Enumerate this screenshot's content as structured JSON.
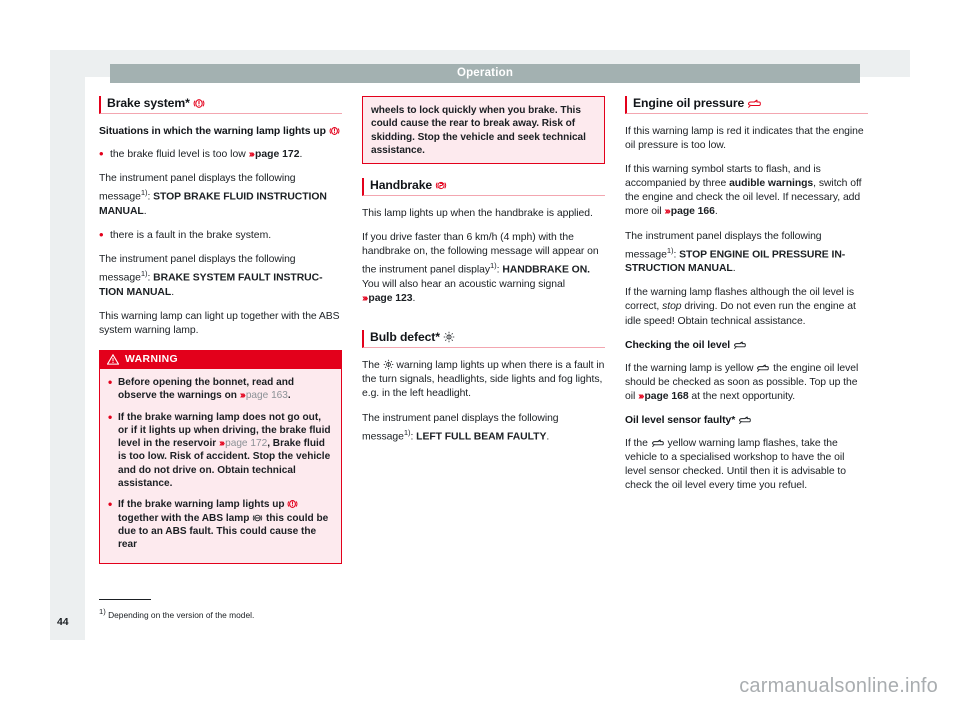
{
  "page": {
    "running_head": "Operation",
    "folio": "44",
    "footnote": "Depending on the version of the model.",
    "footnote_marker": "1)",
    "watermark": "carmanualsonline.info"
  },
  "colors": {
    "accent_red": "#e3001b",
    "warning_bar": "#e3001b",
    "warning_body": "#fdeaee",
    "running_head_bg": "#a3b1b1",
    "page_border": "#eceff0",
    "rule_pink": "#f3a6b0",
    "xref_grey": "#8b9196"
  },
  "column_1": {
    "section": {
      "title": "Brake system*",
      "icon": "brake-warning-icon"
    },
    "subheading": {
      "text": "Situations in which the warning lamp lights up",
      "icon": "brake-warning-icon"
    },
    "bullet_1": {
      "text": "the brake fluid level is too low",
      "xref_arrow": "›››",
      "xref_page": "page 172",
      "tail": "."
    },
    "para_1": {
      "lead": "The instrument panel displays the following message",
      "marker": "1)",
      "colon": ": ",
      "bold": "STOP BRAKE FLUID INSTRUCTION MANUAL",
      "tail": "."
    },
    "bullet_2": {
      "text": "there is a fault in the brake system."
    },
    "para_2": {
      "lead": "The instrument panel displays the following message",
      "marker": "1)",
      "colon": ": ",
      "bold": "BRAKE SYSTEM FAULT INSTRUC-TION MANUAL",
      "tail": "."
    },
    "para_3": "This warning lamp can light up together with the ABS system warning lamp.",
    "warning": {
      "label": "WARNING",
      "icon": "warning-triangle-icon",
      "items": [
        {
          "pre": "Before opening the bonnet, read and observe the warnings on ",
          "xref_arrow": "›››",
          "xref_page": "page 163",
          "post": "."
        },
        {
          "pre": "If the brake warning lamp does not go out, or if it lights up when driving, the brake fluid level in the reservoir ",
          "xref_arrow": "›››",
          "xref_page": "page 172",
          "post": ", Brake fluid is too low. Risk of accident. Stop the vehicle and do not drive on. Obtain technical assistance."
        },
        {
          "pre": "If the brake warning lamp lights up ",
          "icon_1": "brake-warning-icon",
          "mid": " together with the ABS lamp ",
          "icon_2": "abs-warning-icon",
          "post": " this could be due to an ABS fault. This could cause the rear"
        }
      ]
    }
  },
  "column_2": {
    "warning_continued": "wheels to lock quickly when you brake. This could cause the rear to break away. Risk of skidding. Stop the vehicle and seek technical assistance.",
    "handbrake": {
      "section": {
        "title": "Handbrake",
        "icon": "handbrake-p-icon"
      },
      "para_1": "This lamp lights up when the handbrake is applied.",
      "para_2": {
        "lead": "If you drive faster than 6 km/h (4 mph) with the handbrake on, the following message will appear on the instrument panel display",
        "marker": "1)",
        "colon": ": ",
        "bold": "HANDBRAKE ON.",
        "mid": " You will also hear an acoustic warning signal ",
        "xref_arrow": "›››",
        "xref_page": "page 123",
        "tail": "."
      }
    },
    "bulb": {
      "section": {
        "title": "Bulb defect*",
        "icon": "bulb-defect-icon"
      },
      "para_1": {
        "pre": "The ",
        "icon": "bulb-defect-icon",
        "post": " warning lamp lights up when there is a fault in the turn signals, headlights, side lights and fog lights, e.g. in the left headlight."
      },
      "para_2": {
        "lead": "The instrument panel displays the following message",
        "marker": "1)",
        "colon": ": ",
        "bold": "LEFT FULL BEAM FAULTY",
        "tail": "."
      }
    }
  },
  "column_3": {
    "section": {
      "title": "Engine oil pressure",
      "icon": "oil-can-icon"
    },
    "para_1": "If this warning lamp is red it indicates that the engine oil pressure is too low.",
    "para_2": {
      "pre": "If this warning symbol starts to flash, and is accompanied by three ",
      "bold": "audible warnings",
      "mid": ", switch off the engine and check the oil level. If necessary, add more oil ",
      "xref_arrow": "›››",
      "xref_page": "page 166",
      "tail": "."
    },
    "para_3": {
      "lead": "The instrument panel displays the following message",
      "marker": "1)",
      "colon": ": ",
      "bold": "STOP ENGINE OIL PRESSURE IN-STRUCTION MANUAL",
      "tail": "."
    },
    "para_4": {
      "pre": "If the warning lamp flashes although the oil level is correct, ",
      "italic": "stop",
      "post": " driving. Do not even run the engine at idle speed! Obtain technical assistance."
    },
    "subhead_oil_level": {
      "text": "Checking the oil level",
      "icon": "oil-can-icon"
    },
    "para_5": {
      "pre": "If the warning lamp is yellow ",
      "icon": "oil-can-icon",
      "mid": " the engine oil level should be checked as soon as possible. Top up the oil ",
      "xref_arrow": "›››",
      "xref_page": "page 168",
      "post": " at the next opportunity."
    },
    "subhead_sensor": {
      "text": "Oil level sensor faulty*",
      "icon": "oil-can-icon"
    },
    "para_6": {
      "pre": "If the ",
      "icon": "oil-can-icon",
      "post": " yellow warning lamp flashes, take the vehicle to a specialised workshop to have the oil level sensor checked. Until then it is advisable to check the oil level every time you refuel."
    }
  }
}
